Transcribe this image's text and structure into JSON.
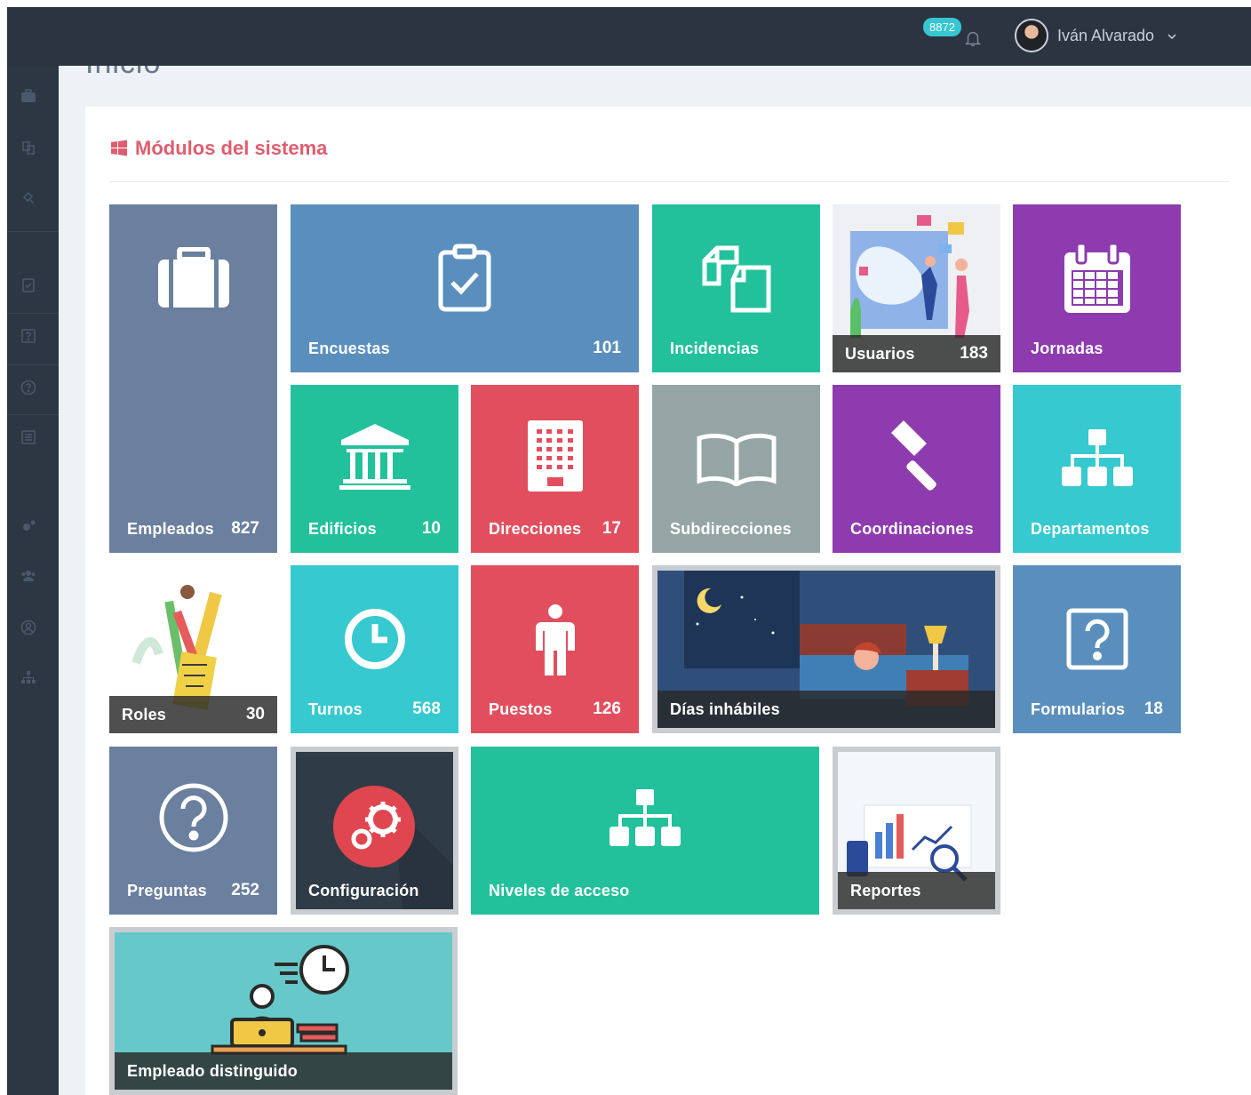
{
  "header": {
    "notifications_count": "8872",
    "user_name": "Iván Alvarado"
  },
  "page": {
    "title": "Inicio"
  },
  "section": {
    "title": "Módulos del sistema"
  },
  "colors": {
    "slate": "#6b7f9e",
    "blue": "#5a8fbd",
    "green": "#23c19b",
    "red": "#e14f5e",
    "gray": "#95a5a6",
    "purple": "#8d3bae",
    "cyan": "#36c9cf",
    "dark": "#2f3c47",
    "accent_title": "#e05d6f"
  },
  "tiles": {
    "empleados": {
      "label": "Empleados",
      "count": "827"
    },
    "encuestas": {
      "label": "Encuestas",
      "count": "101"
    },
    "incidencias": {
      "label": "Incidencias"
    },
    "usuarios": {
      "label": "Usuarios",
      "count": "183"
    },
    "jornadas": {
      "label": "Jornadas"
    },
    "edificios": {
      "label": "Edificios",
      "count": "10"
    },
    "direcciones": {
      "label": "Direcciones",
      "count": "17"
    },
    "subdirecciones": {
      "label": "Subdirecciones"
    },
    "coordinaciones": {
      "label": "Coordinaciones"
    },
    "departamentos": {
      "label": "Departamentos"
    },
    "roles": {
      "label": "Roles",
      "count": "30"
    },
    "turnos": {
      "label": "Turnos",
      "count": "568"
    },
    "puestos": {
      "label": "Puestos",
      "count": "126"
    },
    "dias_inhabiles": {
      "label": "Días inhábiles"
    },
    "formularios": {
      "label": "Formularios",
      "count": "18"
    },
    "preguntas": {
      "label": "Preguntas",
      "count": "252"
    },
    "configuracion": {
      "label": "Configuración"
    },
    "niveles": {
      "label": "Niveles de acceso"
    },
    "reportes": {
      "label": "Reportes"
    },
    "empleado_distinguido": {
      "label": "Empleado distinguido"
    }
  },
  "icons": {
    "sidebar": [
      "briefcase-icon",
      "copy-icon",
      "gavel-icon",
      "clipboard-check-icon",
      "question-square-icon",
      "question-circle-icon",
      "list-icon",
      "gears-icon",
      "users-icon",
      "user-circle-icon",
      "sitemap-icon"
    ]
  }
}
